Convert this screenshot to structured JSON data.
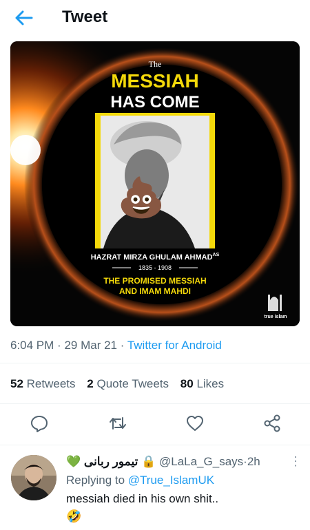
{
  "header": {
    "title": "Tweet",
    "back_icon": "arrow-left-icon"
  },
  "media": {
    "poster_the": "The",
    "poster_line1": "MESSIAH",
    "poster_line2": "HAS COME",
    "poster_name": "HAZRAT MIRZA GHULAM AHMAD",
    "poster_name_sup": "AS",
    "poster_years": "1835 - 1908",
    "poster_sub1": "THE PROMISED MESSIAH",
    "poster_sub2": "AND IMAM MAHDI",
    "poster_logo": "true islam",
    "emoji": "💩"
  },
  "tweet": {
    "time": "6:04 PM",
    "date": "29 Mar 21",
    "source": "Twitter for Android",
    "sep": "·"
  },
  "stats": {
    "retweets_count": "52",
    "retweets_label": "Retweets",
    "quotes_count": "2",
    "quotes_label": "Quote Tweets",
    "likes_count": "80",
    "likes_label": "Likes"
  },
  "actions": [
    "reply-icon",
    "retweet-icon",
    "like-icon",
    "share-icon"
  ],
  "reply": {
    "display_name": "تیمور ربانی",
    "heart": "💚",
    "lock": "🔒",
    "handle": "@LaLa_G_says",
    "age": "2h",
    "sep": "·",
    "more": "⋮",
    "replying_prefix": "Replying to",
    "replying_to": "@True_IslamUK",
    "text": "messiah died in his own shit..",
    "emoji": "🤣"
  },
  "colors": {
    "accent": "#1d9bf0",
    "muted": "#536471",
    "text": "#0f1419",
    "poster_yellow": "#f4d90a"
  }
}
